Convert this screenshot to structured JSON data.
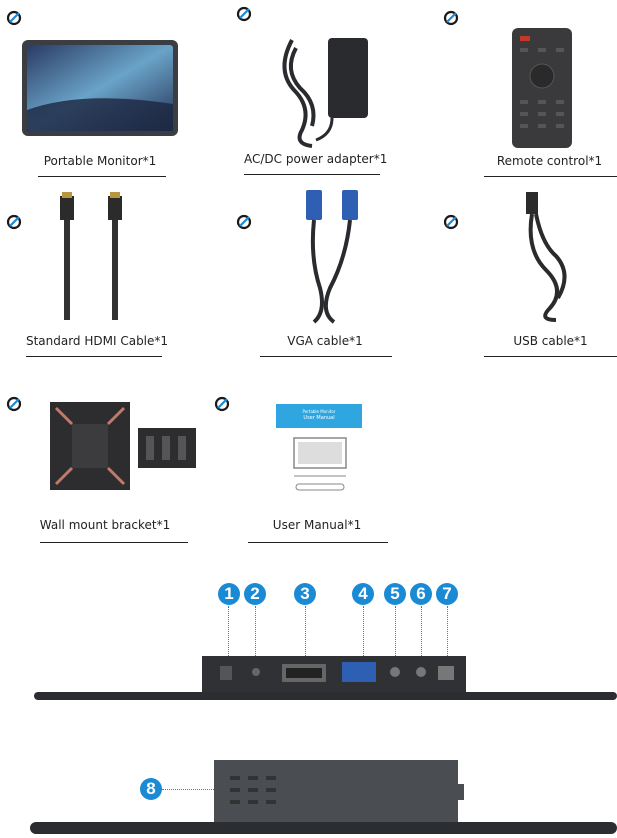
{
  "accessories": [
    {
      "label": "Portable Monitor*1",
      "icon": "check-circle-icon"
    },
    {
      "label": "AC/DC power adapter*1",
      "icon": "check-circle-icon"
    },
    {
      "label": "Remote control*1",
      "icon": "check-circle-icon"
    },
    {
      "label": "Standard HDMI Cable*1",
      "icon": "check-circle-icon"
    },
    {
      "label": "VGA cable*1",
      "icon": "check-circle-icon"
    },
    {
      "label": "USB cable*1",
      "icon": "check-circle-icon"
    },
    {
      "label": "Wall mount bracket*1",
      "icon": "check-circle-icon"
    },
    {
      "label": "User Manual*1",
      "icon": "check-circle-icon"
    }
  ],
  "manual_cover": {
    "line1": "Portable Monitor",
    "line2": "User Manual"
  },
  "ports": [
    "1",
    "2",
    "3",
    "4",
    "5",
    "6",
    "7"
  ],
  "side_port": "8",
  "colors": {
    "accent": "#1a8ad4",
    "check_outline": "#1a1a1a",
    "device": "#2b2d30"
  }
}
